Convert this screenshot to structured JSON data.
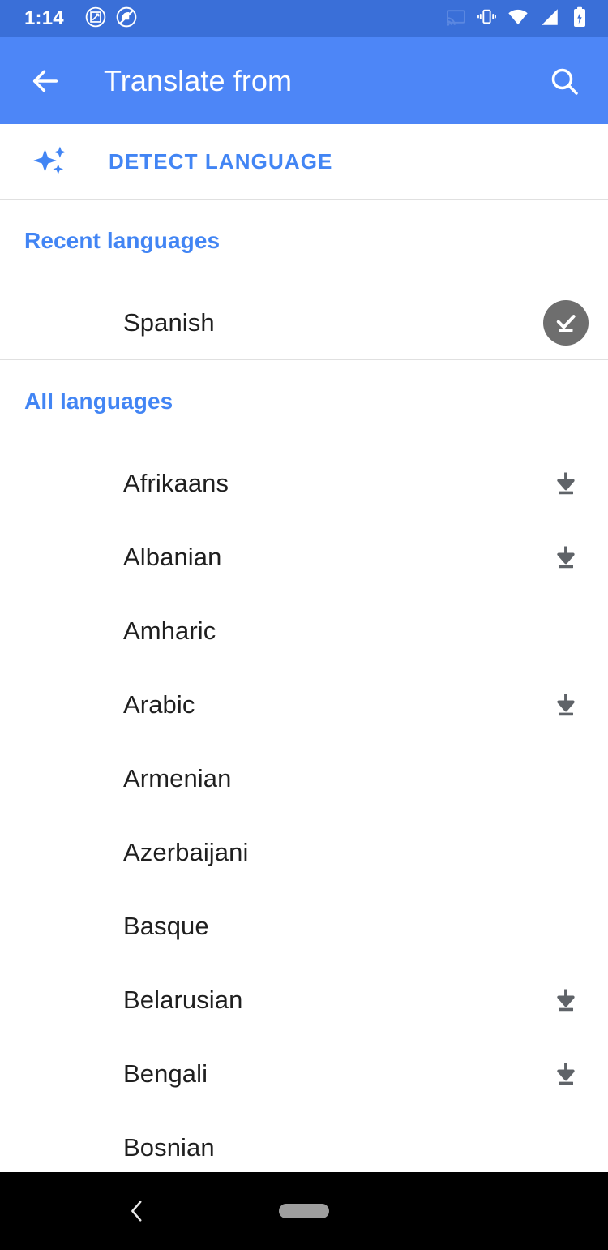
{
  "status_bar": {
    "time": "1:14",
    "left_icons": [
      "screenshot-icon",
      "do-not-disturb-icon"
    ],
    "right_icons": [
      "cast-icon",
      "vibrate-icon",
      "wifi-icon",
      "signal-icon",
      "battery-charging-icon"
    ],
    "background_color": "#3a6fd8"
  },
  "toolbar": {
    "title": "Translate from",
    "back_icon": "arrow-back-icon",
    "search_icon": "search-icon",
    "background_color": "#4d86f7"
  },
  "detect": {
    "label": "DETECT LANGUAGE",
    "icon": "auto-detect-sparkle-icon",
    "accent_color": "#4285f4"
  },
  "sections": [
    {
      "title": "Recent languages",
      "items": [
        {
          "name": "Spanish",
          "trailing": "downloaded-badge"
        }
      ]
    },
    {
      "title": "All languages",
      "items": [
        {
          "name": "Afrikaans",
          "trailing": "download-icon"
        },
        {
          "name": "Albanian",
          "trailing": "download-icon"
        },
        {
          "name": "Amharic",
          "trailing": "none"
        },
        {
          "name": "Arabic",
          "trailing": "download-icon"
        },
        {
          "name": "Armenian",
          "trailing": "none"
        },
        {
          "name": "Azerbaijani",
          "trailing": "none"
        },
        {
          "name": "Basque",
          "trailing": "none"
        },
        {
          "name": "Belarusian",
          "trailing": "download-icon"
        },
        {
          "name": "Bengali",
          "trailing": "download-icon"
        },
        {
          "name": "Bosnian",
          "trailing": "none"
        }
      ]
    }
  ],
  "nav_bar": {
    "back_icon": "nav-back-icon",
    "home_icon": "nav-home-pill",
    "background_color": "#000000"
  },
  "colors": {
    "accent_blue": "#4285f4",
    "text_primary": "#1f1f1f",
    "icon_gray": "#5f6368",
    "badge_gray": "#6e6e6e",
    "divider": "#e0e0e0"
  }
}
